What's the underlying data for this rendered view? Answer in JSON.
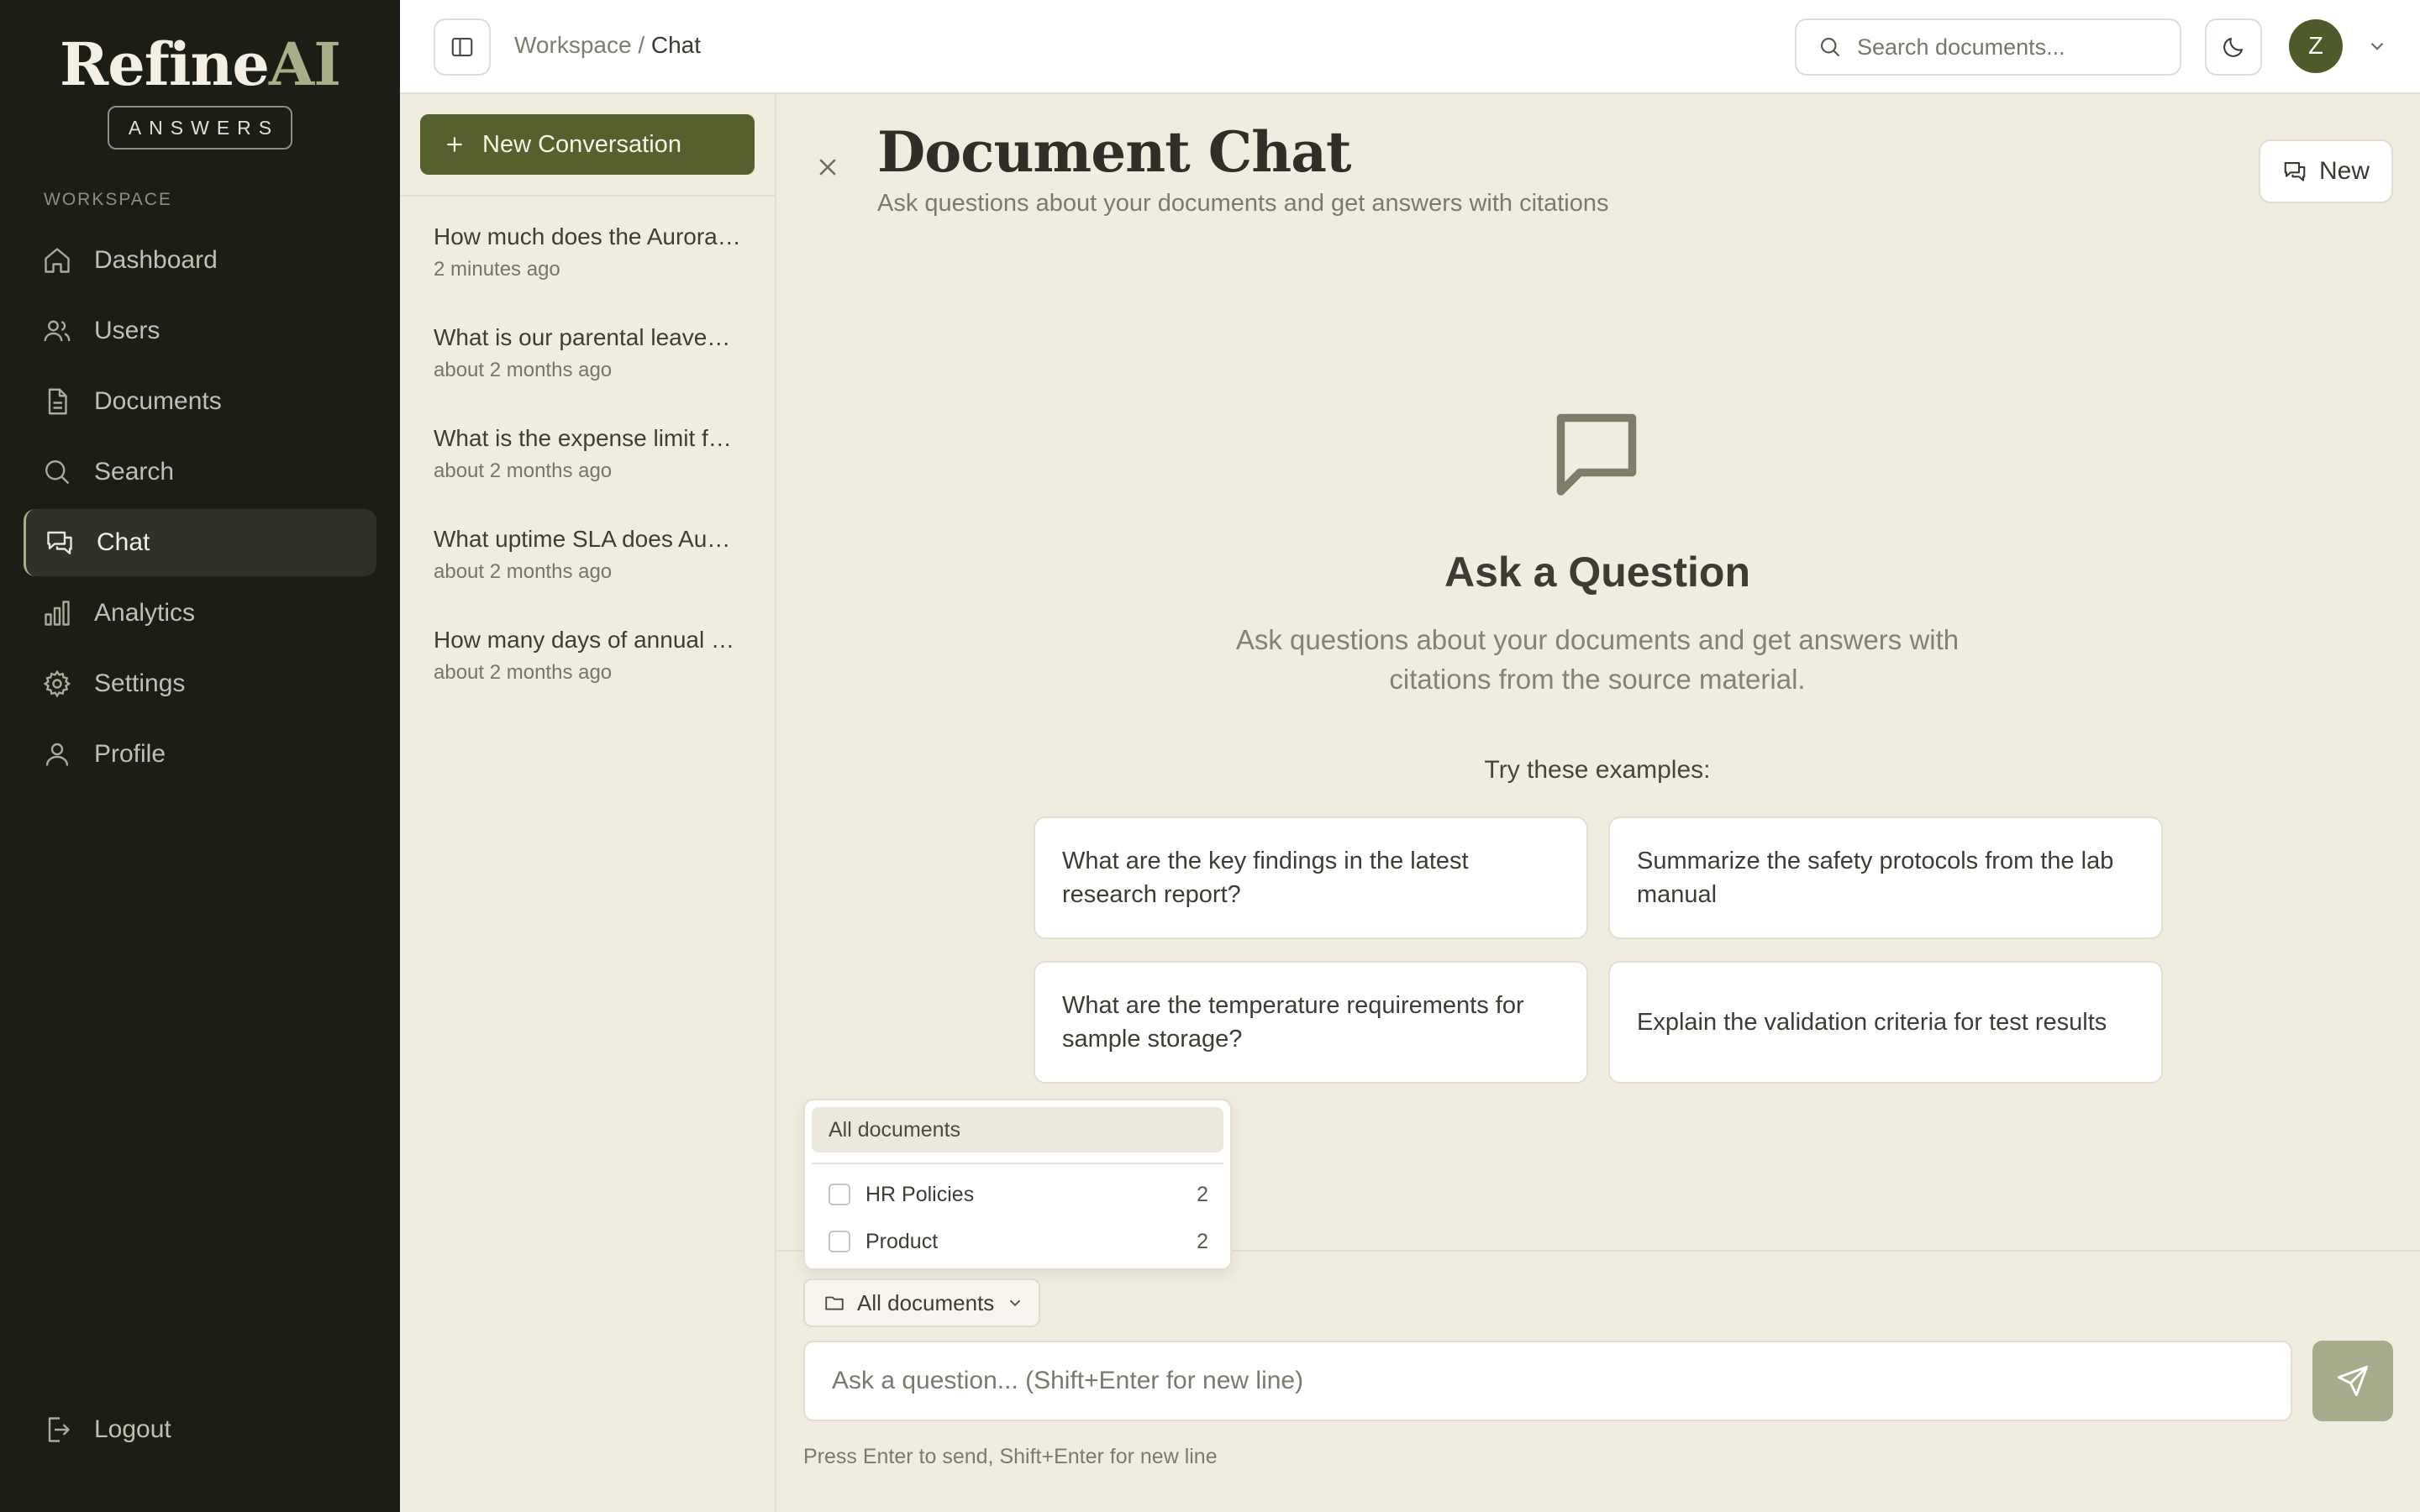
{
  "app": {
    "logo_main": "Refine",
    "logo_accent": "AI",
    "logo_badge": "ANSWERS"
  },
  "sidebar": {
    "section_label": "WORKSPACE",
    "items": [
      {
        "label": "Dashboard",
        "icon": "home-icon",
        "active": false
      },
      {
        "label": "Users",
        "icon": "users-icon",
        "active": false
      },
      {
        "label": "Documents",
        "icon": "document-icon",
        "active": false
      },
      {
        "label": "Search",
        "icon": "search-icon",
        "active": false
      },
      {
        "label": "Chat",
        "icon": "chat-icon",
        "active": true
      },
      {
        "label": "Analytics",
        "icon": "analytics-icon",
        "active": false
      },
      {
        "label": "Settings",
        "icon": "gear-icon",
        "active": false
      },
      {
        "label": "Profile",
        "icon": "user-icon",
        "active": false
      }
    ],
    "logout_label": "Logout"
  },
  "topbar": {
    "breadcrumb_root": "Workspace",
    "breadcrumb_sep": "/",
    "breadcrumb_current": "Chat",
    "search_placeholder": "Search documents...",
    "avatar_initial": "Z"
  },
  "conversations": {
    "new_button_label": "New Conversation",
    "items": [
      {
        "title": "How much does the Aurora…",
        "time": "2 minutes ago"
      },
      {
        "title": "What is our parental leave…",
        "time": "about 2 months ago"
      },
      {
        "title": "What is the expense limit f…",
        "time": "about 2 months ago"
      },
      {
        "title": "What uptime SLA does Au…",
        "time": "about 2 months ago"
      },
      {
        "title": "How many days of annual …",
        "time": "about 2 months ago"
      }
    ]
  },
  "main": {
    "title": "Document Chat",
    "subtitle": "Ask questions about your documents and get answers with citations",
    "new_button_label": "New",
    "empty_title": "Ask a Question",
    "empty_description": "Ask questions about your documents and get answers with citations from the source material.",
    "examples_label": "Try these examples:",
    "examples": [
      "What are the key findings in the latest research report?",
      "Summarize the safety protocols from the lab manual",
      "What are the temperature requirements for sample storage?",
      "Explain the validation criteria for test results"
    ]
  },
  "filter_dropdown": {
    "all_label": "All documents",
    "options": [
      {
        "label": "HR Policies",
        "count": "2",
        "checked": false
      },
      {
        "label": "Product",
        "count": "2",
        "checked": false
      }
    ]
  },
  "composer": {
    "scope_label": "All documents",
    "input_placeholder": "Ask a question... (Shift+Enter for new line)",
    "hint": "Press Enter to send, Shift+Enter for new line"
  },
  "colors": {
    "sidebar_bg": "#1c1e16",
    "accent": "#55602d",
    "page_bg": "#f0ede0",
    "send_button": "#a7ac8d"
  }
}
